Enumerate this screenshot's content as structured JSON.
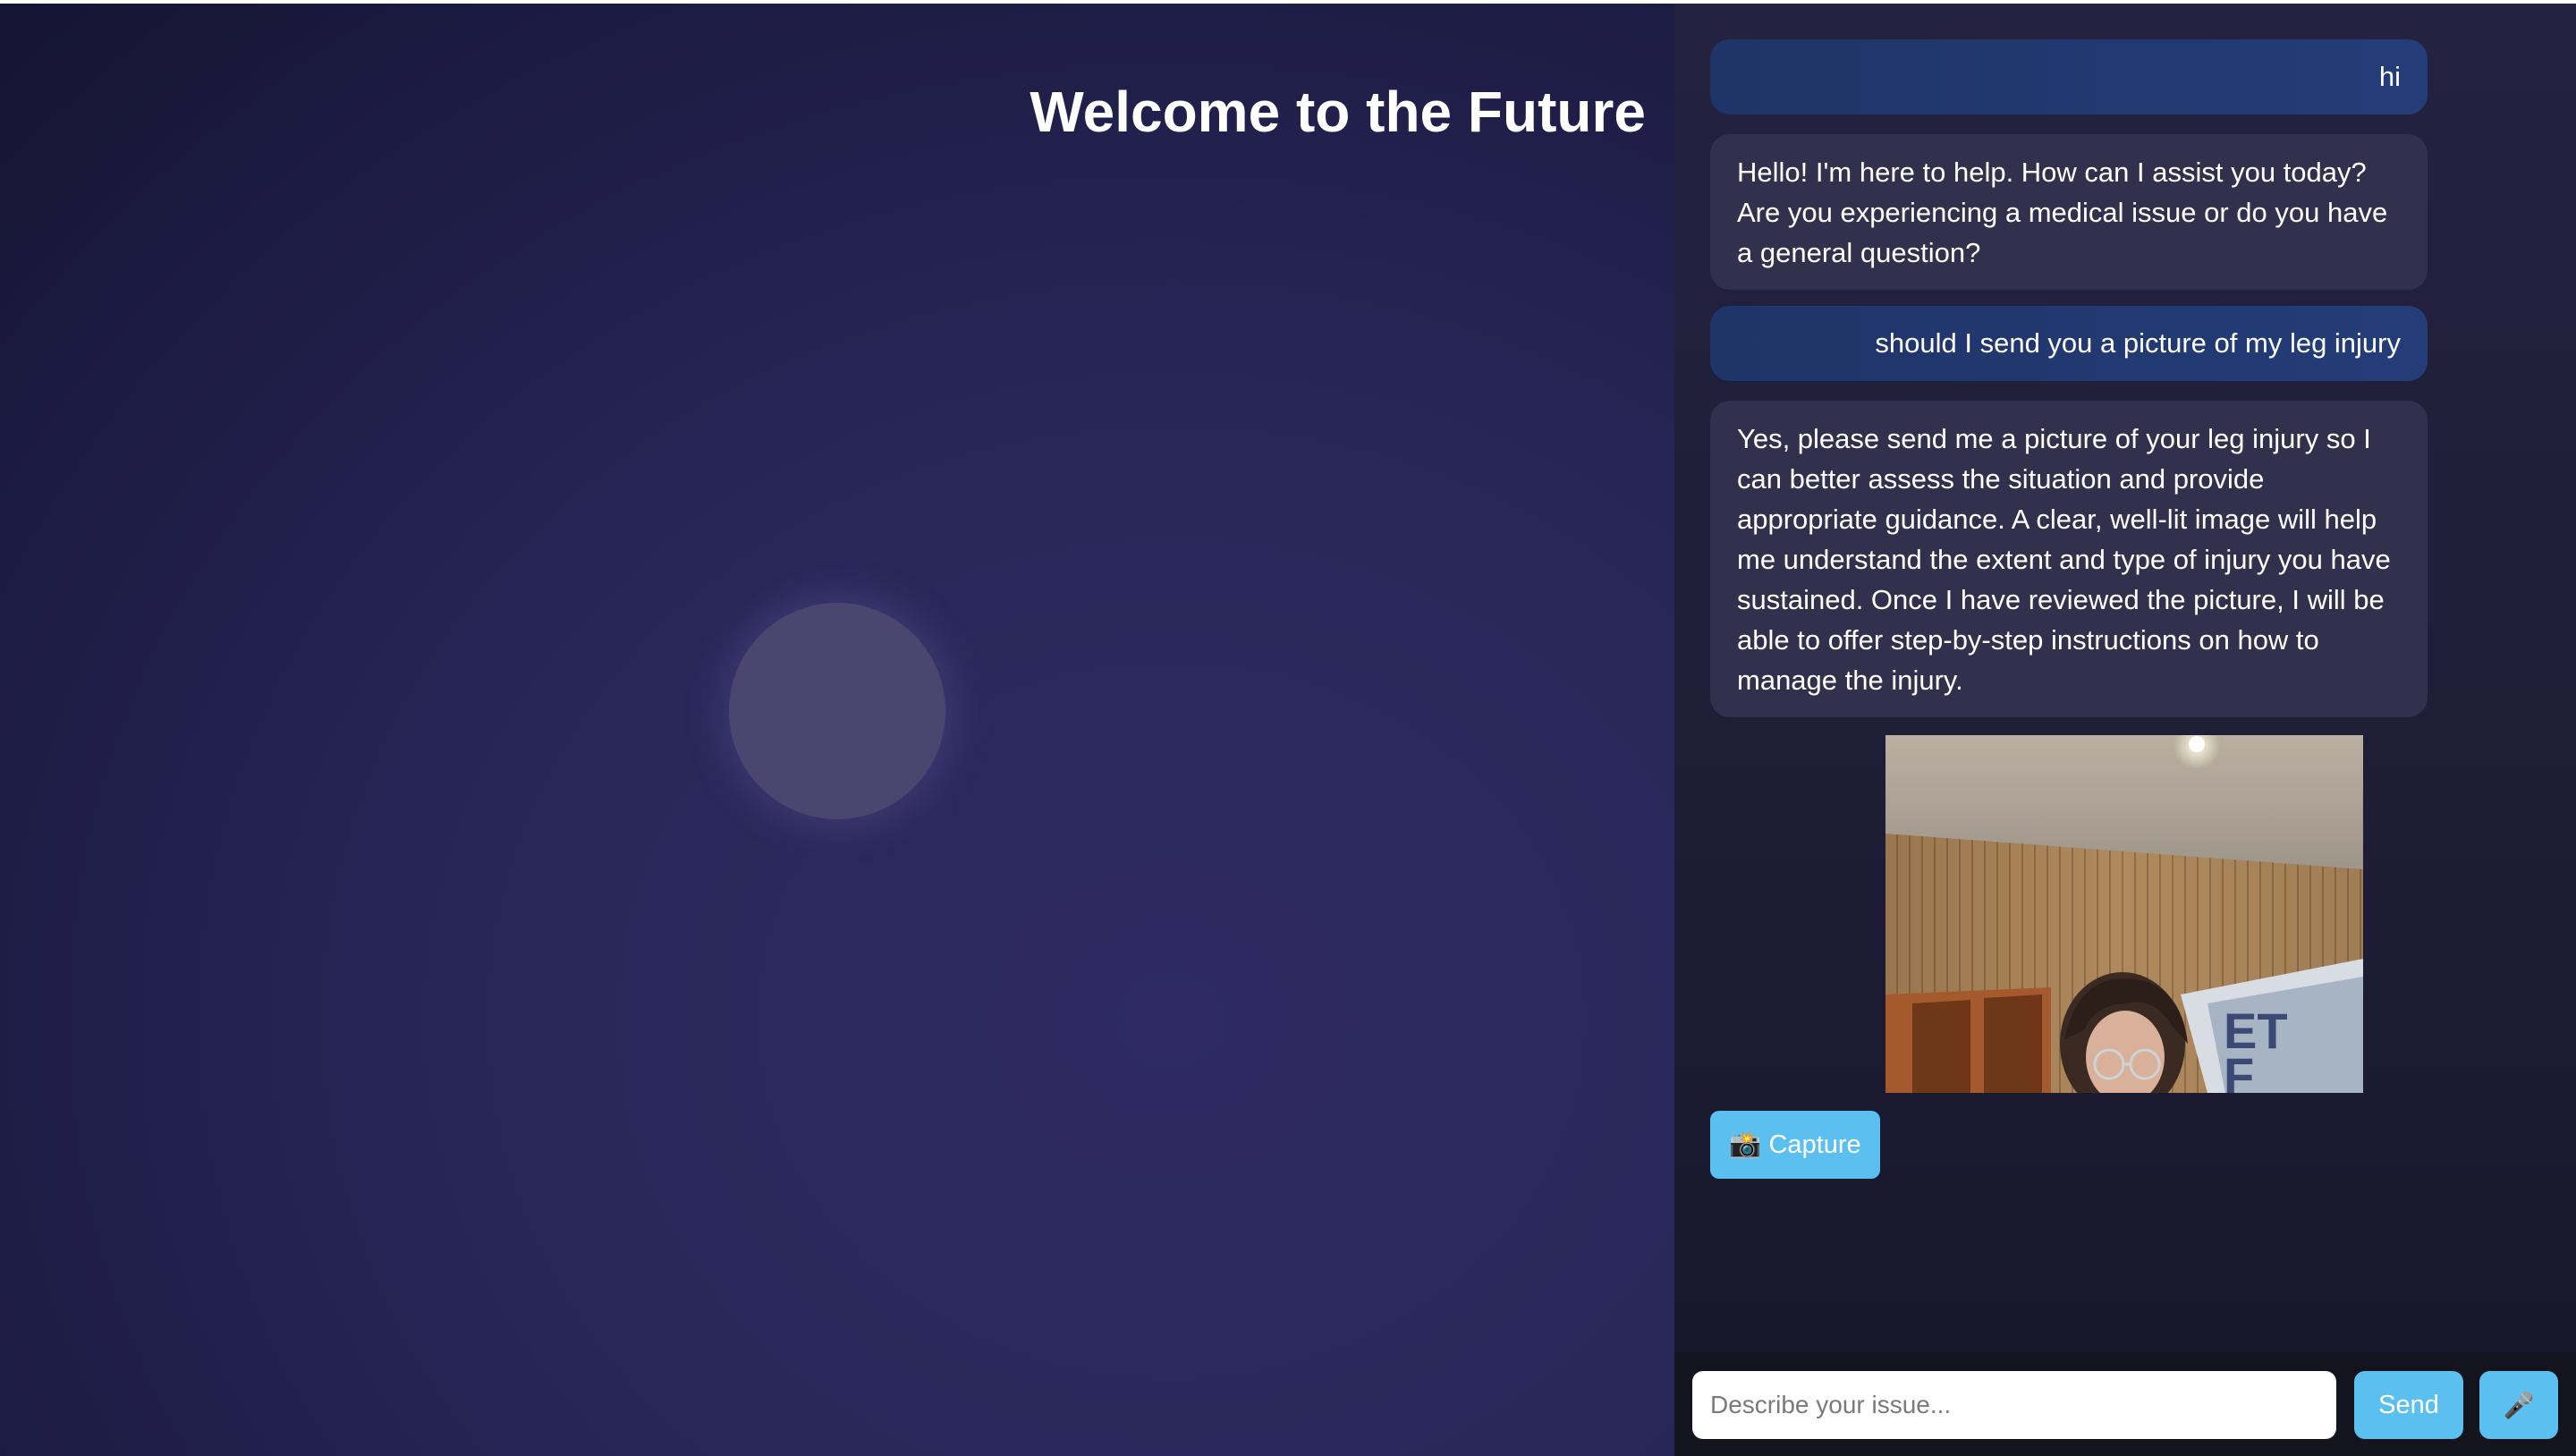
{
  "left": {
    "title": "Welcome to the Future"
  },
  "chat": {
    "messages": [
      {
        "role": "user",
        "text": "hi"
      },
      {
        "role": "assistant",
        "text": "Hello! I'm here to help. How can I assist you today? Are you experiencing a medical issue or do you have a general question?"
      },
      {
        "role": "user",
        "text": "should I send you a picture of my leg injury"
      },
      {
        "role": "assistant",
        "text": "Yes, please send me a picture of your leg injury so I can better assess the situation and provide appropriate guidance. A clear, well-lit image will help me understand the extent and type of injury you have sustained. Once I have reviewed the picture, I will be able to offer step-by-step instructions on how to manage the injury."
      }
    ],
    "capture_label": "📸 Capture"
  },
  "input_bar": {
    "placeholder": "Describe your issue...",
    "send_label": "Send",
    "mic_icon": "microphone-icon",
    "mic_glyph": "🎤"
  },
  "colors": {
    "accent": "#5bc0f0",
    "user_bubble": "#243d78",
    "bot_bubble": "#33304e",
    "background": "#29275a"
  }
}
